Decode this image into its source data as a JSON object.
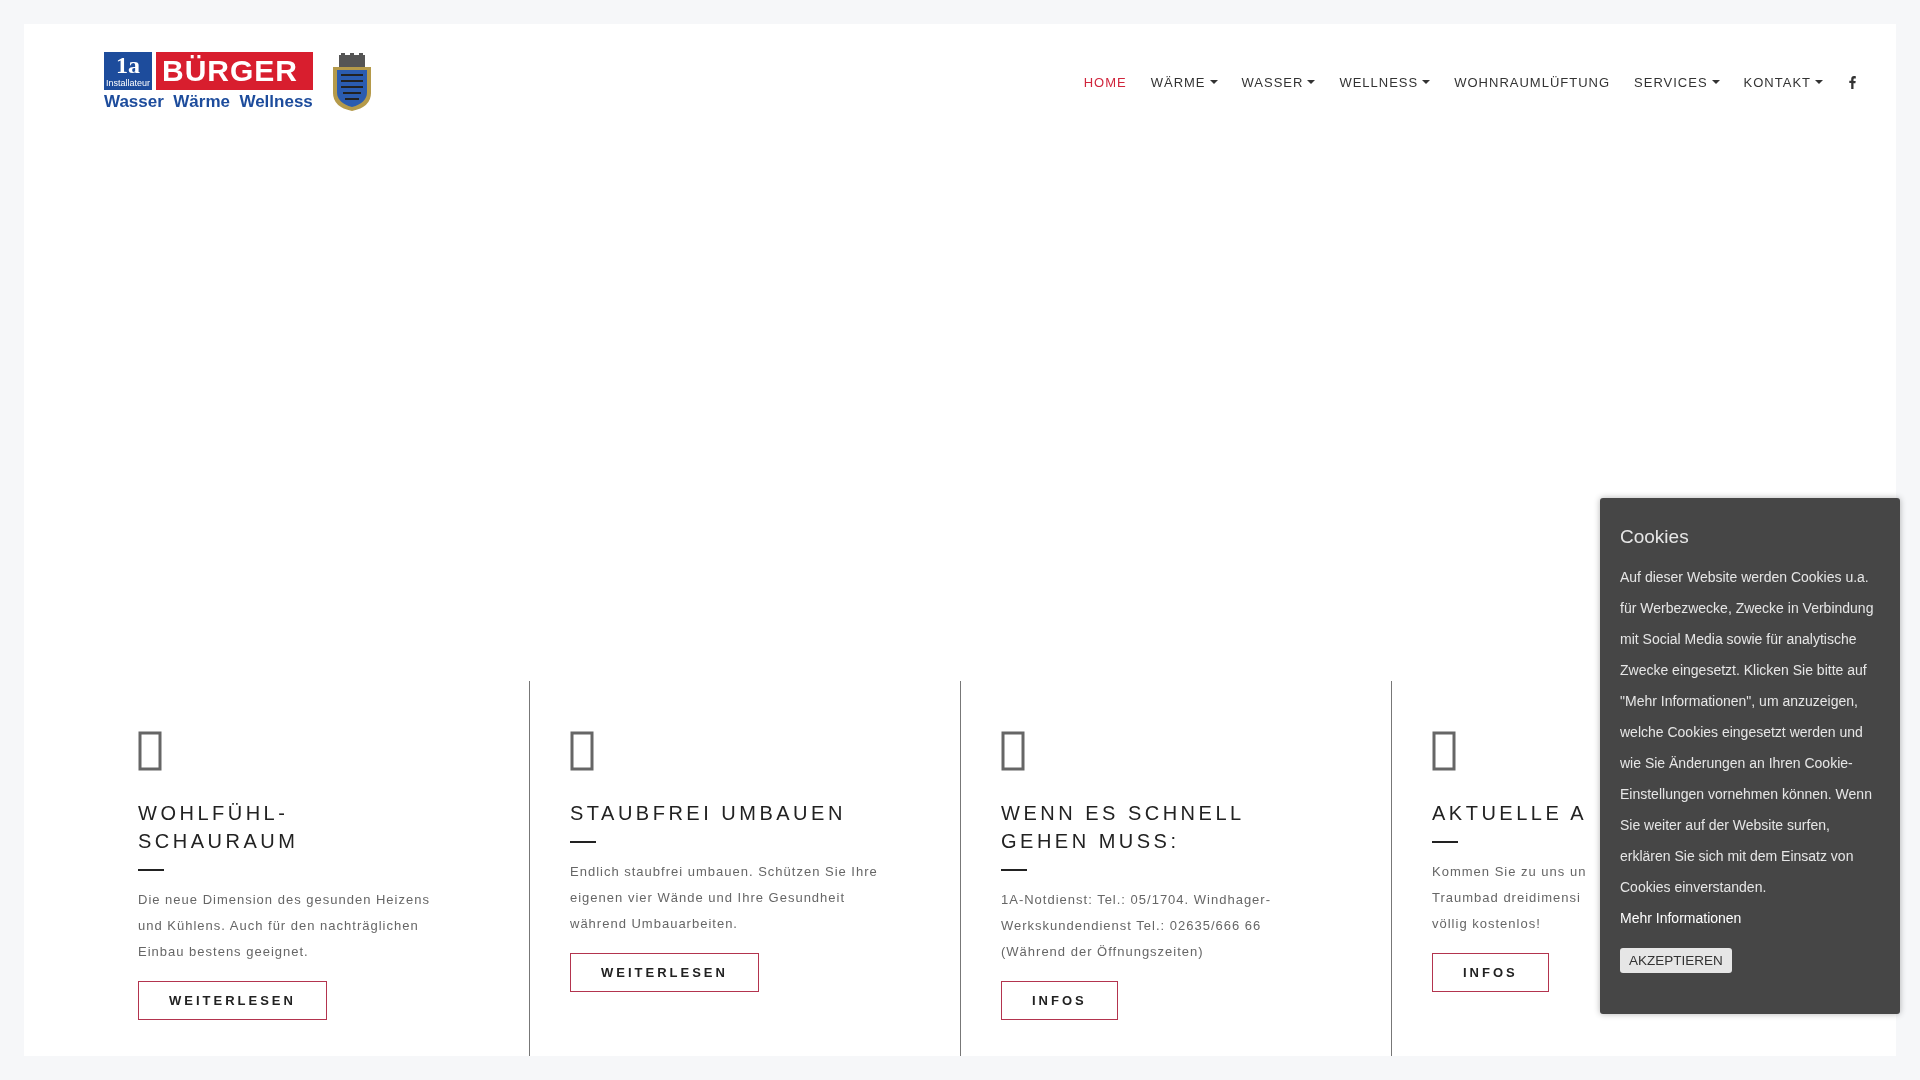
{
  "logo": {
    "badge": "1a",
    "badge_sub": "Installateur",
    "brand": "BÜRGER",
    "tagline": "Wasser  Wärme  Wellness"
  },
  "nav": [
    {
      "label": "HOME",
      "selected": true,
      "has_dropdown": false
    },
    {
      "label": "WÄRME",
      "selected": false,
      "has_dropdown": true
    },
    {
      "label": "WASSER",
      "selected": false,
      "has_dropdown": true
    },
    {
      "label": "WELLNESS",
      "selected": false,
      "has_dropdown": true
    },
    {
      "label": "WOHNRAUMLÜFTUNG",
      "selected": false,
      "has_dropdown": false
    },
    {
      "label": "SERVICES",
      "selected": false,
      "has_dropdown": true
    },
    {
      "label": "KONTAKT",
      "selected": false,
      "has_dropdown": true
    }
  ],
  "features": [
    {
      "title_lines": [
        "WOHLFÜHL-",
        "SCHAURAUM"
      ],
      "body_lines": [
        "Die neue Dimension des gesunden Heizens",
        "und Kühlens. Auch für den nachträglichen",
        "Einbau bestens geeignet."
      ],
      "button": "WEITERLESEN"
    },
    {
      "title_lines": [
        "STAUBFREI UMBAUEN"
      ],
      "body_lines": [
        "Endlich staubfrei umbauen. Schützen Sie Ihre",
        "eigenen vier Wände und Ihre Gesundheit",
        "während Umbauarbeiten."
      ],
      "button": "WEITERLESEN"
    },
    {
      "title_lines": [
        "WENN ES SCHNELL",
        "GEHEN MUSS:"
      ],
      "body_lines": [
        "1A-Notdienst: Tel.: 05/1704. Windhager-",
        "Werkskundendienst Tel.: 02635/666 66",
        "(Während der Öffnungszeiten)"
      ],
      "button": "INFOS"
    },
    {
      "title_lines": [
        "AKTUELLE A"
      ],
      "body_lines": [
        "Kommen Sie zu uns un",
        "Traumbad dreidimensi",
        "völlig kostenlos!"
      ],
      "button": "INFOS"
    }
  ],
  "cookie": {
    "title": "Cookies",
    "text": "Auf dieser Website werden Cookies u.a. für Werbezwecke, Zwecke in Verbindung mit Social Media sowie für analytische Zwecke eingesetzt. Klicken Sie bitte auf \"Mehr Informationen\", um anzuzeigen, welche Cookies eingesetzt werden und wie Sie Änderungen an Ihren Cookie-Einstellungen vornehmen können. Wenn Sie weiter auf der Website surfen, erklären Sie sich mit dem Einsatz von Cookies einverstanden.",
    "link": "Mehr Informationen",
    "button": "AKZEPTIEREN"
  }
}
